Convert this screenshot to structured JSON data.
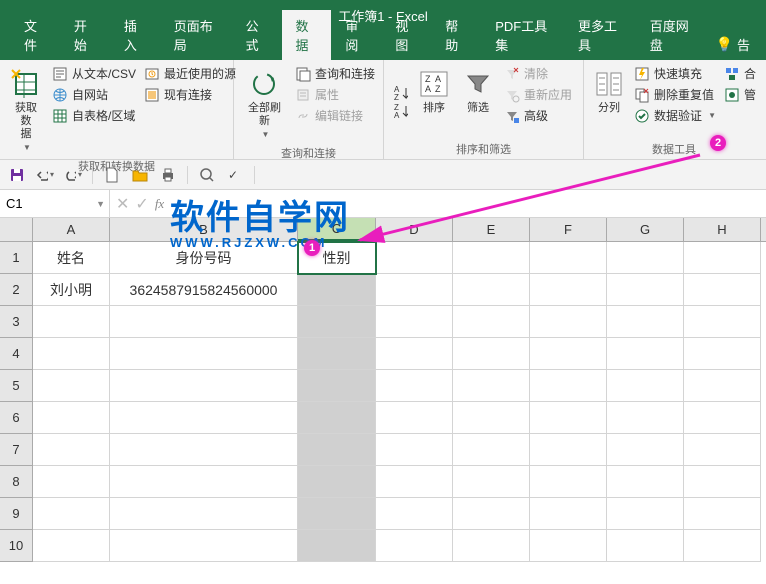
{
  "title": "工作簿1 - Excel",
  "tabs": [
    "文件",
    "开始",
    "插入",
    "页面布局",
    "公式",
    "数据",
    "审阅",
    "视图",
    "帮助",
    "PDF工具集",
    "更多工具",
    "百度网盘"
  ],
  "active_tab": "数据",
  "tell_me": "告",
  "ribbon": {
    "get_data": {
      "big": "获取数\n据",
      "items": [
        "从文本/CSV",
        "自网站",
        "自表格/区域",
        "最近使用的源",
        "现有连接"
      ],
      "title": "获取和转换数据"
    },
    "refresh": {
      "big": "全部刷新",
      "items": [
        "查询和连接",
        "属性",
        "编辑链接"
      ],
      "title": "查询和连接"
    },
    "sort": {
      "big1": "排序",
      "big2": "筛选",
      "items": [
        "清除",
        "重新应用",
        "高级"
      ],
      "title": "排序和筛选"
    },
    "columns": {
      "big": "分列",
      "items": [
        "快速填充",
        "删除重复值",
        "数据验证",
        "合",
        "管"
      ],
      "title": "数据工具"
    }
  },
  "namebox": "C1",
  "formula": "",
  "col_headers": [
    "A",
    "B",
    "C",
    "D",
    "E",
    "F",
    "G",
    "H"
  ],
  "rows": [
    1,
    2,
    3,
    4,
    5,
    6,
    7,
    8,
    9,
    10
  ],
  "cells": {
    "A1": "姓名",
    "B1": "身份号码",
    "C1": "性别",
    "A2": "刘小明",
    "B2": "3624587915824560000"
  },
  "selected_col": "C",
  "active_cell": "C1",
  "watermark": {
    "main": "软件自学网",
    "sub": "WWW.RJZXW.COM"
  },
  "callouts": {
    "c1": "1",
    "c2": "2"
  }
}
